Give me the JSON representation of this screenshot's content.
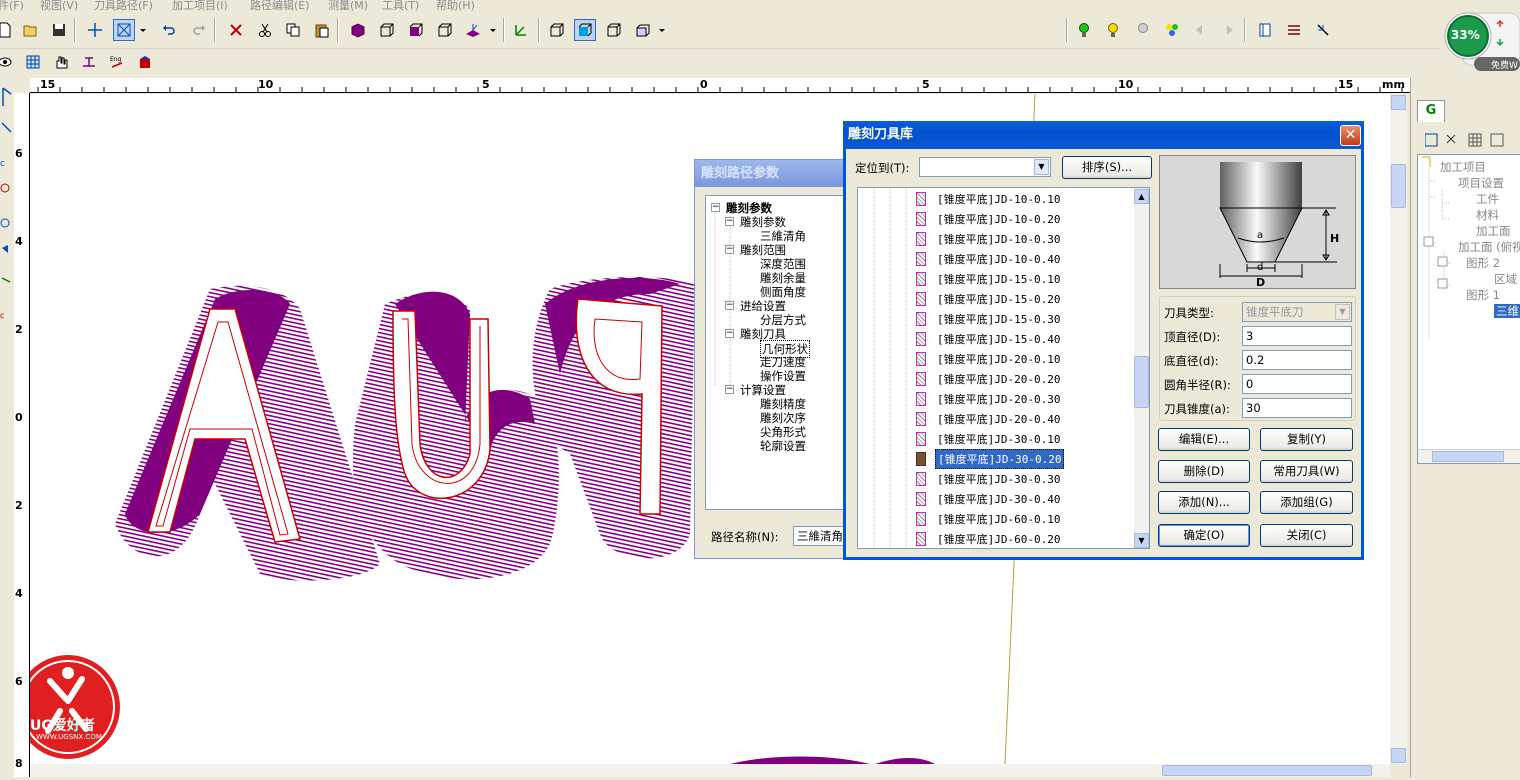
{
  "menu": [
    "件(F)",
    "视图(V)",
    "刀具路径(F)",
    "加工项目(I)",
    "路径编辑(E)",
    "测量(M)",
    "工具(T)",
    "帮助(H)"
  ],
  "ruler": {
    "unit": "mm",
    "top_labels": [
      "15",
      "10",
      "5",
      "0",
      "5",
      "10",
      "15"
    ],
    "left_labels": [
      "6",
      "4",
      "2",
      "0",
      "2",
      "4",
      "6",
      "8"
    ]
  },
  "status_widget": {
    "percent": "33%",
    "wifi_text": "免费W"
  },
  "right_panel": {
    "tab": "G",
    "tree": [
      "加工项目",
      "项目设置",
      "工件",
      "材料",
      "加工面",
      "加工面 (俯视",
      "图形 2",
      "区域",
      "图形 1",
      "三维"
    ]
  },
  "path_dialog": {
    "title": "雕刻路径参数",
    "tree": [
      {
        "label": "雕刻参数",
        "level": 0,
        "bold": true,
        "box": "−"
      },
      {
        "label": "雕刻参数",
        "level": 1,
        "box": "−"
      },
      {
        "label": "三維清角",
        "level": 2
      },
      {
        "label": "雕刻范围",
        "level": 1,
        "box": "−"
      },
      {
        "label": "深度范围",
        "level": 2
      },
      {
        "label": "雕刻余量",
        "level": 2
      },
      {
        "label": "侧面角度",
        "level": 2
      },
      {
        "label": "进给设置",
        "level": 1,
        "box": "−"
      },
      {
        "label": "分层方式",
        "level": 2
      },
      {
        "label": "雕刻刀具",
        "level": 1,
        "box": "−"
      },
      {
        "label": "几何形状",
        "level": 2
      },
      {
        "label": "走刀速度",
        "level": 2
      },
      {
        "label": "操作设置",
        "level": 2
      },
      {
        "label": "计算设置",
        "level": 1,
        "box": "−"
      },
      {
        "label": "雕刻精度",
        "level": 2
      },
      {
        "label": "雕刻次序",
        "level": 2
      },
      {
        "label": "尖角形式",
        "level": 2
      },
      {
        "label": "轮廓设置",
        "level": 2
      }
    ],
    "path_name_label": "路径名称(N):",
    "path_name_value": "三維清角"
  },
  "tool_dialog": {
    "title": "雕刻刀具库",
    "locate_label": "定位到(T):",
    "locate_value": "",
    "sort_button": "排序(S)...",
    "tools": [
      "[锥度平底]JD-10-0.10",
      "[锥度平底]JD-10-0.20",
      "[锥度平底]JD-10-0.30",
      "[锥度平底]JD-10-0.40",
      "[锥度平底]JD-15-0.10",
      "[锥度平底]JD-15-0.20",
      "[锥度平底]JD-15-0.30",
      "[锥度平底]JD-15-0.40",
      "[锥度平底]JD-20-0.10",
      "[锥度平底]JD-20-0.20",
      "[锥度平底]JD-20-0.30",
      "[锥度平底]JD-20-0.40",
      "[锥度平底]JD-30-0.10",
      "[锥度平底]JD-30-0.20",
      "[锥度平底]JD-30-0.30",
      "[锥度平底]JD-30-0.40",
      "[锥度平底]JD-60-0.10",
      "[锥度平底]JD-60-0.20"
    ],
    "selected_index": 13,
    "diagram_labels": {
      "a": "a",
      "H": "H",
      "d": "d",
      "D": "D"
    },
    "props": {
      "type_label": "刀具类型:",
      "type_value": "锥度平底刀",
      "top_diameter_label": "顶直径(D):",
      "top_diameter_value": "3",
      "bottom_diameter_label": "底直径(d):",
      "bottom_diameter_value": "0.2",
      "corner_radius_label": "圆角半径(R):",
      "corner_radius_value": "0",
      "taper_label": "刀具锥度(a):",
      "taper_value": "30"
    },
    "buttons": {
      "edit": "编辑(E)...",
      "copy": "复制(Y)",
      "delete": "删除(D)",
      "common": "常用刀具(W)",
      "add": "添加(N)...",
      "add_group": "添加组(G)",
      "ok": "确定(O)",
      "close": "关闭(C)"
    }
  },
  "watermark": {
    "brand": "UG爱好者",
    "url": "WWW.UGSNX.COM"
  },
  "colors": {
    "extrusion": "#800080",
    "outline": "#cc0000",
    "title_active": "#0054e3",
    "selection": "#316ac5"
  }
}
